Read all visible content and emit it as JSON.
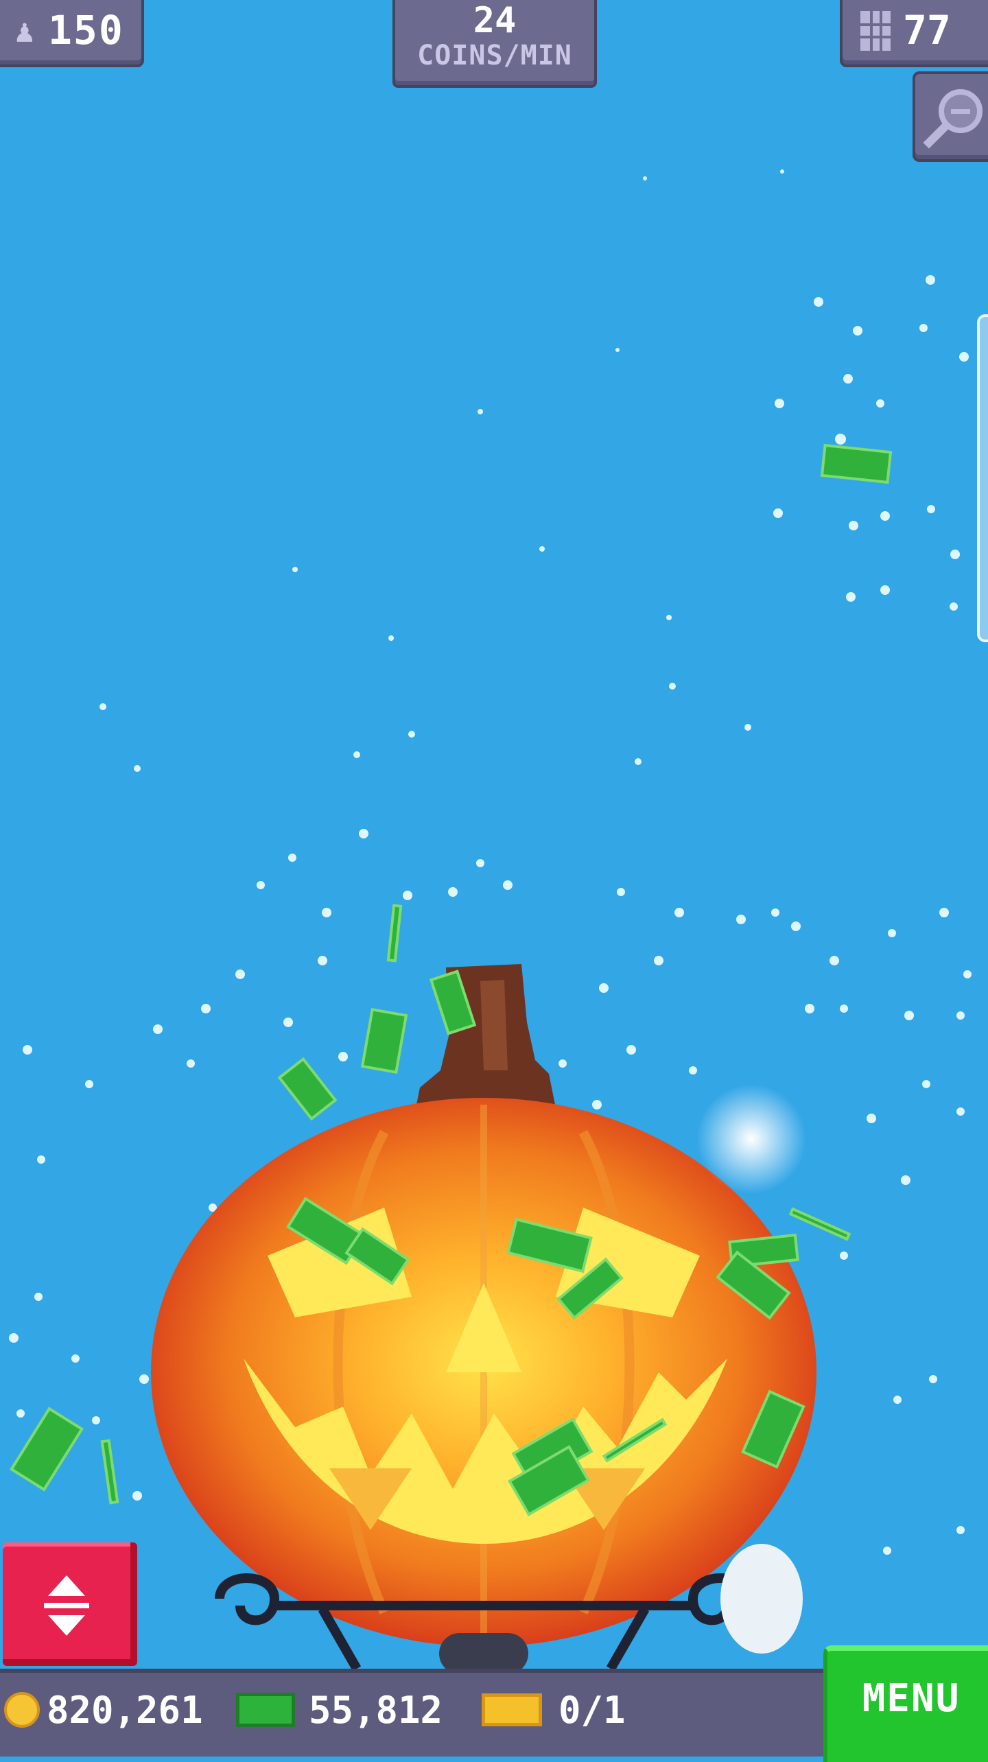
{
  "hud": {
    "population": "150",
    "population_icon": "person-icon",
    "rate_value": "24",
    "rate_label": "COINS/MIN",
    "floors": "77",
    "floors_icon": "building-icon",
    "zoom_icon": "magnifier-zoom-out-icon"
  },
  "bottom_bar": {
    "coins": "820,261",
    "cash": "55,812",
    "tickets": "0/1",
    "coin_icon": "coin-icon",
    "cash_icon": "banknote-icon",
    "ticket_icon": "golden-ticket-icon"
  },
  "buttons": {
    "menu_label": "MENU",
    "elevator_icon": "up-down-arrows-icon"
  },
  "colors": {
    "sky": "#33a6e6",
    "panel": "#6c6a8e",
    "menu_green": "#23c52f",
    "elevator_red": "#e8224f",
    "pumpkin": "#f07a1e"
  }
}
